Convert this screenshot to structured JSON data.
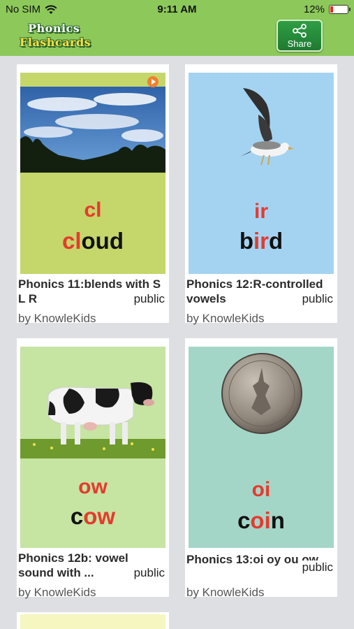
{
  "status": {
    "carrier": "No SIM",
    "time": "9:11 AM",
    "battery": "12%"
  },
  "nav": {
    "logo_line1": "Phonics",
    "logo_line2": "Flashcards",
    "share_label": "Share"
  },
  "cards": [
    {
      "title": "Phonics 11:blends with S L R",
      "visibility": "public",
      "author": "by KnowleKids",
      "sound": "cl",
      "word_hl": "cl",
      "word_rest": "oud",
      "bg": "#c5d66b",
      "image": "sky-clouds-photo"
    },
    {
      "title": "Phonics 12:R-controlled vowels",
      "visibility": "public",
      "author": "by KnowleKids",
      "sound": "ir",
      "word_pre": "b",
      "word_hl": "ir",
      "word_rest": "d",
      "bg": "#a4d3f2",
      "image": "bird-photo"
    },
    {
      "title": "Phonics 12b: vowel sound with ...",
      "visibility": "public",
      "author": "by KnowleKids",
      "sound": "ow",
      "word_pre": "c",
      "word_hl": "ow",
      "word_rest": "",
      "bg": "#c6e4a2",
      "image": "cow-photo"
    },
    {
      "title": "Phonics 13:oi oy ou ow",
      "visibility": "public",
      "author": "by KnowleKids",
      "sound": "oi",
      "word_pre": "c",
      "word_hl": "oi",
      "word_rest": "n",
      "bg": "#a4d6c8",
      "image": "coin-photo"
    }
  ],
  "colors": {
    "nav_bg": "#8cc85a",
    "share_bg": "#2f9e44",
    "accent_red": "#e53a2e",
    "page_bg": "#dedfe3"
  }
}
